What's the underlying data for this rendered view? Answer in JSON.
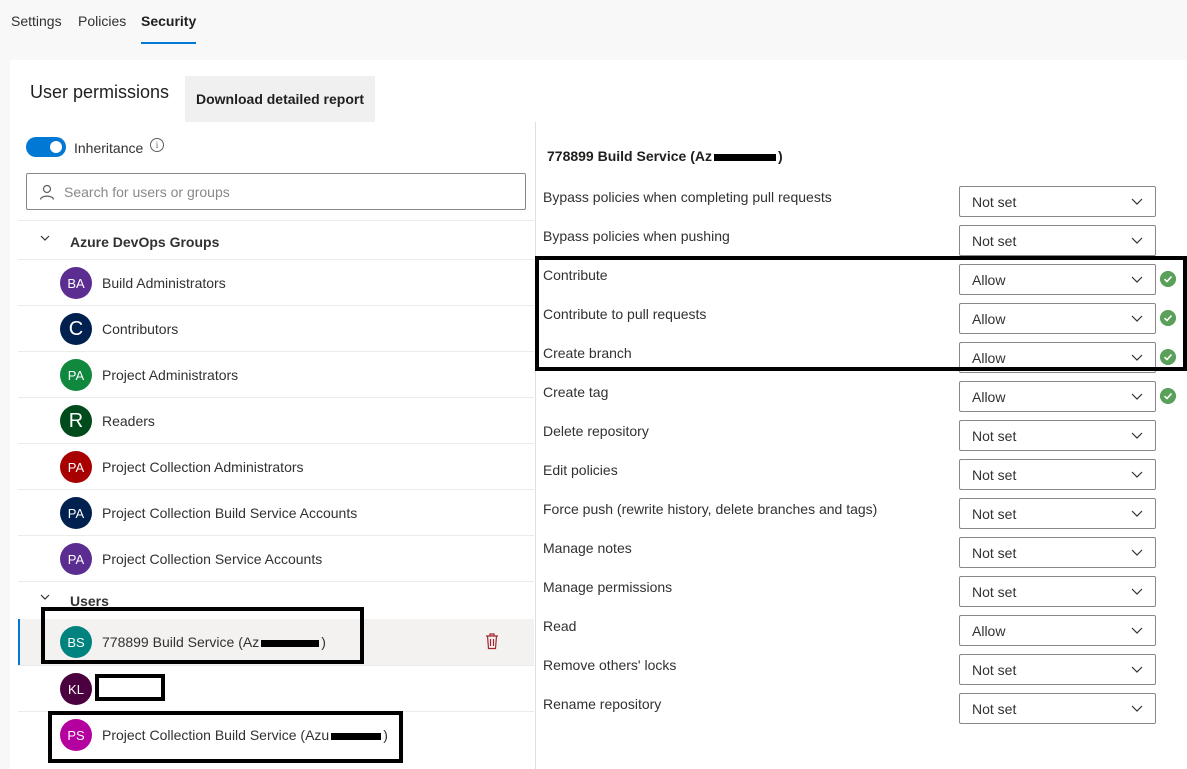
{
  "tabs": [
    {
      "label": "Settings"
    },
    {
      "label": "Policies"
    },
    {
      "label": "Security",
      "active": true
    }
  ],
  "page": {
    "title": "User permissions",
    "download_button": "Download detailed report"
  },
  "inheritance": {
    "label": "Inheritance",
    "enabled": true,
    "info_icon": "info-icon"
  },
  "search": {
    "placeholder": "Search for users or groups",
    "value": ""
  },
  "groups_section": {
    "label": "Azure DevOps Groups",
    "items": [
      {
        "initials": "BA",
        "name": "Build Administrators",
        "color": "#5c2d91"
      },
      {
        "initials": "C",
        "name": "Contributors",
        "color": "#002050"
      },
      {
        "initials": "PA",
        "name": "Project Administrators",
        "color": "#10893e"
      },
      {
        "initials": "R",
        "name": "Readers",
        "color": "#004b1c"
      },
      {
        "initials": "PA",
        "name": "Project Collection Administrators",
        "color": "#a80000"
      },
      {
        "initials": "PA",
        "name": "Project Collection Build Service Accounts",
        "color": "#002050"
      },
      {
        "initials": "PA",
        "name": "Project Collection Service Accounts",
        "color": "#5c2d91"
      }
    ]
  },
  "users_section": {
    "label": "Users",
    "items": [
      {
        "initials": "BS",
        "name_prefix": "778899 Build Service (Az",
        "name_suffix": ")",
        "color": "#00827f",
        "selected": true
      },
      {
        "initials": "KL",
        "name_prefix": "",
        "name_suffix": "",
        "color": "#4b003f"
      },
      {
        "initials": "PS",
        "name_prefix": "Project Collection Build Service (Azu",
        "name_suffix": ")",
        "color": "#b4009e"
      }
    ]
  },
  "details": {
    "title_prefix": "778899 Build Service (Az",
    "title_suffix": ")",
    "permissions": [
      {
        "label": "Bypass policies when completing pull requests",
        "value": "Not set",
        "check": false
      },
      {
        "label": "Bypass policies when pushing",
        "value": "Not set",
        "check": false
      },
      {
        "label": "Contribute",
        "value": "Allow",
        "check": true
      },
      {
        "label": "Contribute to pull requests",
        "value": "Allow",
        "check": true
      },
      {
        "label": "Create branch",
        "value": "Allow",
        "check": true
      },
      {
        "label": "Create tag",
        "value": "Allow",
        "check": true
      },
      {
        "label": "Delete repository",
        "value": "Not set",
        "check": false
      },
      {
        "label": "Edit policies",
        "value": "Not set",
        "check": false
      },
      {
        "label": "Force push (rewrite history, delete branches and tags)",
        "value": "Not set",
        "check": false
      },
      {
        "label": "Manage notes",
        "value": "Not set",
        "check": false
      },
      {
        "label": "Manage permissions",
        "value": "Not set",
        "check": false
      },
      {
        "label": "Read",
        "value": "Allow",
        "check": false
      },
      {
        "label": "Remove others' locks",
        "value": "Not set",
        "check": false
      },
      {
        "label": "Rename repository",
        "value": "Not set",
        "check": false
      }
    ]
  },
  "colors": {
    "accent": "#0078d4",
    "allow_check": "#5aa05a"
  }
}
